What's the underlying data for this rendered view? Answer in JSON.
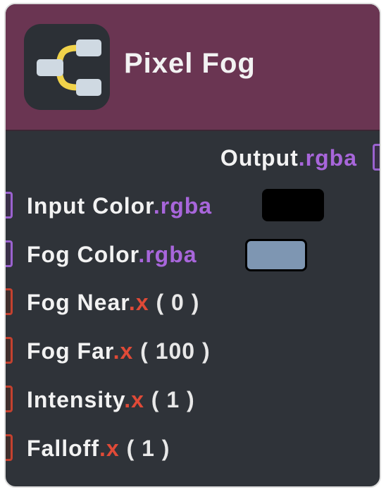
{
  "node": {
    "title": "Pixel Fog",
    "icon": "branch-icon",
    "colors": {
      "header": "#6a3552",
      "body": "#2f3339",
      "vector_port": "#9b62d0",
      "scalar_port": "#c4412f"
    }
  },
  "output": {
    "label": "Output",
    "swizzle": ".rgba"
  },
  "inputs": [
    {
      "label": "Input Color",
      "swizzle": ".rgba",
      "swatch": "#000000"
    },
    {
      "label": "Fog Color",
      "swizzle": ".rgba",
      "swatch": "#7e96b2"
    },
    {
      "label": "Fog Near",
      "swizzle": ".x",
      "value": " ( 0 )"
    },
    {
      "label": "Fog Far",
      "swizzle": ".x",
      "value": " ( 100 )"
    },
    {
      "label": "Intensity",
      "swizzle": ".x",
      "value": " ( 1 )"
    },
    {
      "label": "Falloff",
      "swizzle": ".x",
      "value": " ( 1 )"
    }
  ]
}
